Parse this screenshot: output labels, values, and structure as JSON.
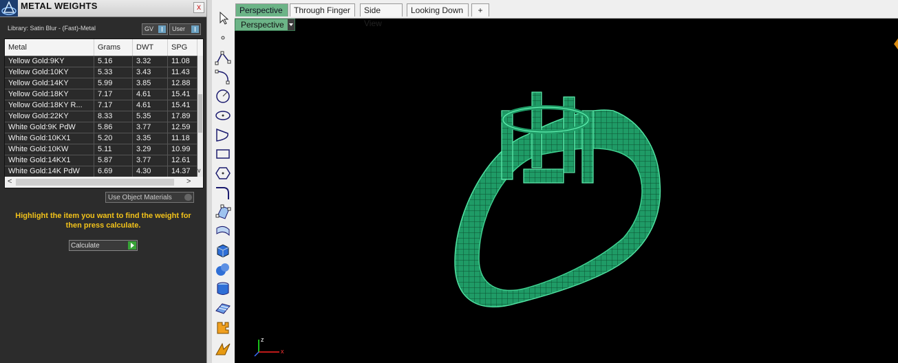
{
  "panel": {
    "title": "METAL WEIGHTS",
    "close_label": "x",
    "library_label": "Library: Satin Blur - (Fast)-Metal",
    "gv_label": "GV",
    "user_label": "User",
    "table": {
      "headers": [
        "Metal",
        "Grams",
        "DWT",
        "SPG"
      ],
      "rows": [
        [
          "Yellow Gold:9KY",
          "5.16",
          "3.32",
          "11.08"
        ],
        [
          "Yellow Gold:10KY",
          "5.33",
          "3.43",
          "11.43"
        ],
        [
          "Yellow Gold:14KY",
          "5.99",
          "3.85",
          "12.88"
        ],
        [
          "Yellow Gold:18KY",
          "7.17",
          "4.61",
          "15.41"
        ],
        [
          "Yellow Gold:18KY R...",
          "7.17",
          "4.61",
          "15.41"
        ],
        [
          "Yellow Gold:22KY",
          "8.33",
          "5.35",
          "17.89"
        ],
        [
          "White Gold:9K PdW",
          "5.86",
          "3.77",
          "12.59"
        ],
        [
          "White Gold:10KX1",
          "5.20",
          "3.35",
          "11.18"
        ],
        [
          "White Gold:10KW",
          "5.11",
          "3.29",
          "10.99"
        ],
        [
          "White Gold:14KX1",
          "5.87",
          "3.77",
          "12.61"
        ],
        [
          "White Gold:14K PdW",
          "6.69",
          "4.30",
          "14.37"
        ]
      ]
    },
    "use_object_materials": "Use Object Materials",
    "instruction": "Highlight the item you want to find the weight for then press calculate.",
    "calculate_label": "Calculate"
  },
  "toolbar": {
    "icons": [
      "select-arrow-icon",
      "point-icon",
      "polyline-icon",
      "curve-point-icon",
      "circle-icon",
      "ellipse-icon",
      "arc-icon",
      "rectangle-icon",
      "polygon-icon",
      "fillet-curve-icon",
      "surface-points-icon",
      "extrude-surface-icon",
      "box-solid-icon",
      "sphere-solid-icon",
      "cylinder-solid-icon",
      "plane-surface-icon",
      "puzzle-plugin-icon",
      "jewelry-tool-icon"
    ]
  },
  "viewport": {
    "tabs": [
      "Perspective",
      "Through Finger",
      "Side View",
      "Looking Down",
      "+"
    ],
    "active_tab": "Perspective",
    "view_menu_label": "Perspective",
    "axis_labels": {
      "z": "z",
      "x": "x"
    },
    "colors": {
      "model": "#1f9b66",
      "active_tab": "#6cb487",
      "accent_yellow": "#f2c21a"
    }
  }
}
